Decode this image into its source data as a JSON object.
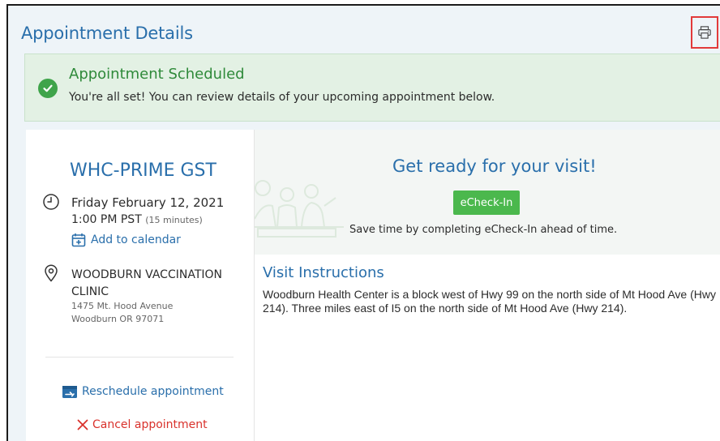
{
  "page": {
    "title": "Appointment Details",
    "print_icon": "printer-icon"
  },
  "banner": {
    "icon": "check-circle-icon",
    "title": "Appointment Scheduled",
    "message": "You're all set! You can review details of your upcoming appointment below."
  },
  "appointment": {
    "clinic": "WHC-PRIME GST",
    "date": "Friday February 12, 2021",
    "time": "1:00 PM PST",
    "duration": "(15 minutes)",
    "add_to_calendar": "Add to calendar",
    "location_name": "WOODBURN VACCINATION CLINIC",
    "address_line1": "1475 Mt. Hood Avenue",
    "address_line2": "Woodburn OR 97071",
    "reschedule": "Reschedule appointment",
    "cancel": "Cancel appointment"
  },
  "visit": {
    "ready_title": "Get ready for your visit!",
    "echeckin_button": "eCheck-In",
    "echeckin_note": "Save time by completing eCheck-In ahead of time.",
    "instructions_title": "Visit Instructions",
    "instructions_text": "Woodburn Health Center is a block west of Hwy 99 on the north side of Mt Hood Ave (Hwy 214). Three miles east of I5 on the north side of Mt Hood Ave (Hwy 214)."
  },
  "colors": {
    "accent": "#2a6fab",
    "success": "#3fa44a",
    "danger": "#d9312b",
    "button": "#4bb84d"
  }
}
